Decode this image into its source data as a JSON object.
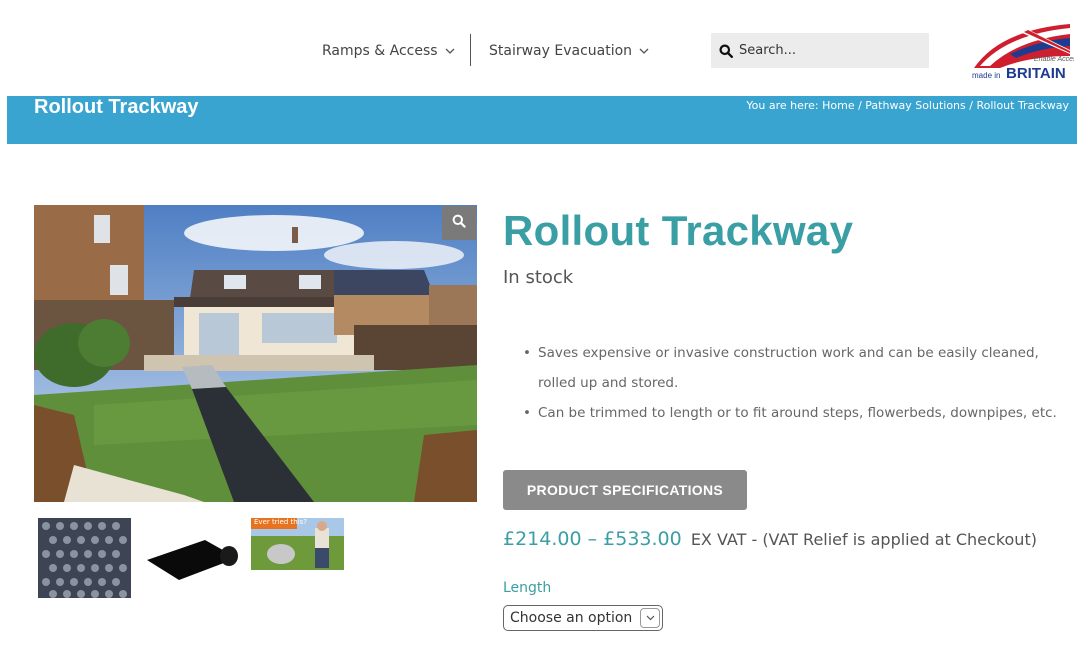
{
  "nav": {
    "items": [
      {
        "label": "Ramps & Access",
        "icon": "chevron-down-icon"
      },
      {
        "label": "Stairway Evacuation",
        "icon": "chevron-down-icon"
      }
    ],
    "search": {
      "placeholder": "Search..."
    },
    "logo": {
      "text": "made in BRITAIN"
    }
  },
  "titlebar": {
    "title": "Rollout Trackway",
    "breadcrumb": {
      "prefix": "You are here:",
      "items": [
        "Home",
        "Pathway Solutions",
        "Rollout Trackway"
      ],
      "separator": "/"
    }
  },
  "product": {
    "title": "Rollout Trackway",
    "stock": "In stock",
    "bullets": [
      "Saves expensive or invasive construction work and can be easily cleaned, rolled up and stored.",
      "Can be trimmed to length or to fit around steps, flowerbeds, downpipes, etc."
    ],
    "spec_button": "PRODUCT SPECIFICATIONS",
    "price": "£214.00 – £533.00",
    "vat_note": "EX VAT - (VAT Relief is applied at Checkout)",
    "option_label": "Length",
    "option_selected": "Choose an option",
    "thumb3_caption": "Ever tried this?"
  },
  "colors": {
    "accent": "#3a9ea5",
    "titlebar": "#3aa4d0",
    "button": "#8a8a8a"
  }
}
